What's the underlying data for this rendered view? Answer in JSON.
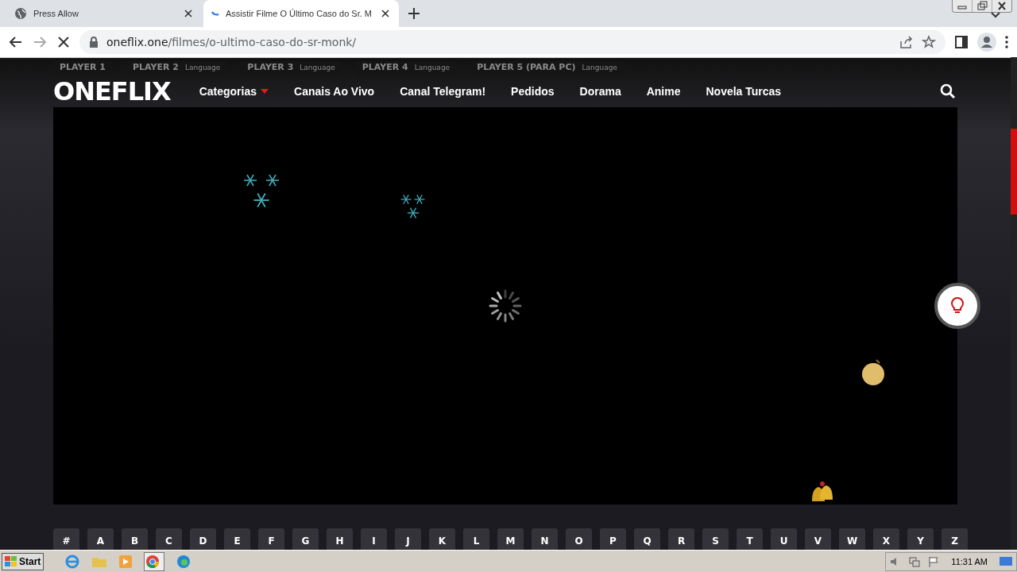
{
  "browser": {
    "tabs": [
      {
        "title": "Press Allow",
        "selected": false,
        "loading": false
      },
      {
        "title": "Assistir Filme O Último Caso do Sr. M",
        "selected": true,
        "loading": true
      }
    ],
    "url_host": "oneflix.one",
    "url_path": "/filmes/o-ultimo-caso-do-sr-monk/"
  },
  "site": {
    "logo": "ONEFLIX",
    "players": [
      {
        "label": "PLAYER 1"
      },
      {
        "label": "PLAYER 2",
        "sub": "Language"
      },
      {
        "label": "PLAYER 3",
        "sub": "Language"
      },
      {
        "label": "PLAYER 4",
        "sub": "Language"
      },
      {
        "label": "PLAYER 5 (PARA PC)",
        "sub": "Language"
      }
    ],
    "nav": [
      {
        "label": "Categorias",
        "dropdown": true
      },
      {
        "label": "Canais Ao Vivo",
        "dropdown": false
      },
      {
        "label": "Canal Telegram!",
        "dropdown": false
      },
      {
        "label": "Pedidos",
        "dropdown": false
      },
      {
        "label": "Dorama",
        "dropdown": false
      },
      {
        "label": "Anime",
        "dropdown": false
      },
      {
        "label": "Novela Turcas",
        "dropdown": false
      }
    ],
    "letters": [
      "#",
      "A",
      "B",
      "C",
      "D",
      "E",
      "F",
      "G",
      "H",
      "I",
      "J",
      "K",
      "L",
      "M",
      "N",
      "O",
      "P",
      "Q",
      "R",
      "S",
      "T",
      "U",
      "V",
      "W",
      "X",
      "Y",
      "Z"
    ]
  },
  "taskbar": {
    "start": "Start",
    "clock": "11:31 AM"
  }
}
